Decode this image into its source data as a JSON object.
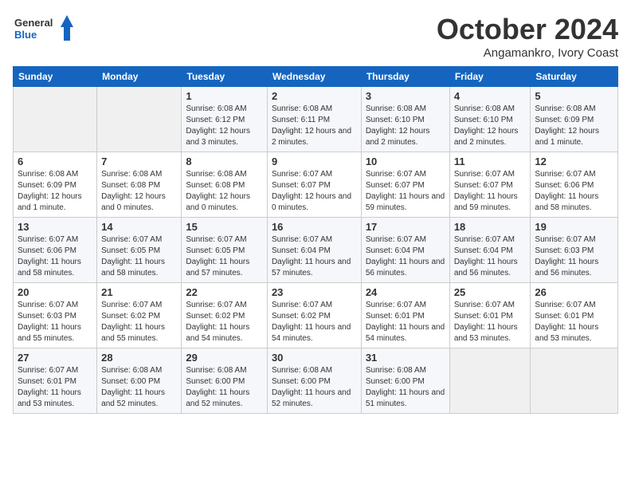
{
  "logo": {
    "line1": "General",
    "line2": "Blue"
  },
  "title": "October 2024",
  "subtitle": "Angamankro, Ivory Coast",
  "days_of_week": [
    "Sunday",
    "Monday",
    "Tuesday",
    "Wednesday",
    "Thursday",
    "Friday",
    "Saturday"
  ],
  "weeks": [
    [
      {
        "day": "",
        "info": ""
      },
      {
        "day": "",
        "info": ""
      },
      {
        "day": "1",
        "info": "Sunrise: 6:08 AM\nSunset: 6:12 PM\nDaylight: 12 hours and 3 minutes."
      },
      {
        "day": "2",
        "info": "Sunrise: 6:08 AM\nSunset: 6:11 PM\nDaylight: 12 hours and 2 minutes."
      },
      {
        "day": "3",
        "info": "Sunrise: 6:08 AM\nSunset: 6:10 PM\nDaylight: 12 hours and 2 minutes."
      },
      {
        "day": "4",
        "info": "Sunrise: 6:08 AM\nSunset: 6:10 PM\nDaylight: 12 hours and 2 minutes."
      },
      {
        "day": "5",
        "info": "Sunrise: 6:08 AM\nSunset: 6:09 PM\nDaylight: 12 hours and 1 minute."
      }
    ],
    [
      {
        "day": "6",
        "info": "Sunrise: 6:08 AM\nSunset: 6:09 PM\nDaylight: 12 hours and 1 minute."
      },
      {
        "day": "7",
        "info": "Sunrise: 6:08 AM\nSunset: 6:08 PM\nDaylight: 12 hours and 0 minutes."
      },
      {
        "day": "8",
        "info": "Sunrise: 6:08 AM\nSunset: 6:08 PM\nDaylight: 12 hours and 0 minutes."
      },
      {
        "day": "9",
        "info": "Sunrise: 6:07 AM\nSunset: 6:07 PM\nDaylight: 12 hours and 0 minutes."
      },
      {
        "day": "10",
        "info": "Sunrise: 6:07 AM\nSunset: 6:07 PM\nDaylight: 11 hours and 59 minutes."
      },
      {
        "day": "11",
        "info": "Sunrise: 6:07 AM\nSunset: 6:07 PM\nDaylight: 11 hours and 59 minutes."
      },
      {
        "day": "12",
        "info": "Sunrise: 6:07 AM\nSunset: 6:06 PM\nDaylight: 11 hours and 58 minutes."
      }
    ],
    [
      {
        "day": "13",
        "info": "Sunrise: 6:07 AM\nSunset: 6:06 PM\nDaylight: 11 hours and 58 minutes."
      },
      {
        "day": "14",
        "info": "Sunrise: 6:07 AM\nSunset: 6:05 PM\nDaylight: 11 hours and 58 minutes."
      },
      {
        "day": "15",
        "info": "Sunrise: 6:07 AM\nSunset: 6:05 PM\nDaylight: 11 hours and 57 minutes."
      },
      {
        "day": "16",
        "info": "Sunrise: 6:07 AM\nSunset: 6:04 PM\nDaylight: 11 hours and 57 minutes."
      },
      {
        "day": "17",
        "info": "Sunrise: 6:07 AM\nSunset: 6:04 PM\nDaylight: 11 hours and 56 minutes."
      },
      {
        "day": "18",
        "info": "Sunrise: 6:07 AM\nSunset: 6:04 PM\nDaylight: 11 hours and 56 minutes."
      },
      {
        "day": "19",
        "info": "Sunrise: 6:07 AM\nSunset: 6:03 PM\nDaylight: 11 hours and 56 minutes."
      }
    ],
    [
      {
        "day": "20",
        "info": "Sunrise: 6:07 AM\nSunset: 6:03 PM\nDaylight: 11 hours and 55 minutes."
      },
      {
        "day": "21",
        "info": "Sunrise: 6:07 AM\nSunset: 6:02 PM\nDaylight: 11 hours and 55 minutes."
      },
      {
        "day": "22",
        "info": "Sunrise: 6:07 AM\nSunset: 6:02 PM\nDaylight: 11 hours and 54 minutes."
      },
      {
        "day": "23",
        "info": "Sunrise: 6:07 AM\nSunset: 6:02 PM\nDaylight: 11 hours and 54 minutes."
      },
      {
        "day": "24",
        "info": "Sunrise: 6:07 AM\nSunset: 6:01 PM\nDaylight: 11 hours and 54 minutes."
      },
      {
        "day": "25",
        "info": "Sunrise: 6:07 AM\nSunset: 6:01 PM\nDaylight: 11 hours and 53 minutes."
      },
      {
        "day": "26",
        "info": "Sunrise: 6:07 AM\nSunset: 6:01 PM\nDaylight: 11 hours and 53 minutes."
      }
    ],
    [
      {
        "day": "27",
        "info": "Sunrise: 6:07 AM\nSunset: 6:01 PM\nDaylight: 11 hours and 53 minutes."
      },
      {
        "day": "28",
        "info": "Sunrise: 6:08 AM\nSunset: 6:00 PM\nDaylight: 11 hours and 52 minutes."
      },
      {
        "day": "29",
        "info": "Sunrise: 6:08 AM\nSunset: 6:00 PM\nDaylight: 11 hours and 52 minutes."
      },
      {
        "day": "30",
        "info": "Sunrise: 6:08 AM\nSunset: 6:00 PM\nDaylight: 11 hours and 52 minutes."
      },
      {
        "day": "31",
        "info": "Sunrise: 6:08 AM\nSunset: 6:00 PM\nDaylight: 11 hours and 51 minutes."
      },
      {
        "day": "",
        "info": ""
      },
      {
        "day": "",
        "info": ""
      }
    ]
  ]
}
